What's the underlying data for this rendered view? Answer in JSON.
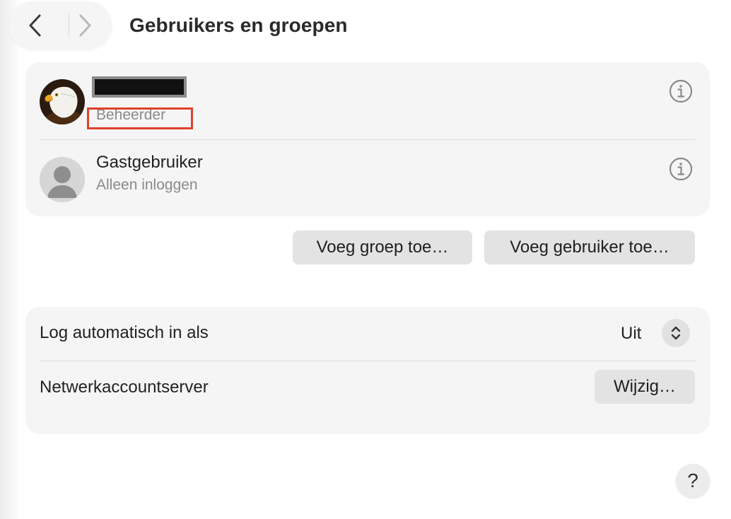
{
  "header": {
    "title": "Gebruikers en groepen",
    "back_icon": "chevron-left-icon",
    "forward_icon": "chevron-right-icon"
  },
  "users": {
    "admin": {
      "role": "Beheerder",
      "avatar_icon": "eagle-avatar"
    },
    "guest": {
      "name": "Gastgebruiker",
      "role": "Alleen inloggen",
      "avatar_icon": "person-avatar-icon"
    }
  },
  "actions": {
    "add_group": "Voeg groep toe…",
    "add_user": "Voeg gebruiker toe…"
  },
  "settings": {
    "auto_login_label": "Log automatisch in als",
    "auto_login_value": "Uit",
    "network_server_label": "Netwerkaccountserver",
    "network_server_button": "Wijzig…"
  },
  "help": {
    "label": "?"
  },
  "colors": {
    "card_background": "#f5f5f5",
    "button_background": "#e3e3e3",
    "highlight": "#e0412c"
  }
}
